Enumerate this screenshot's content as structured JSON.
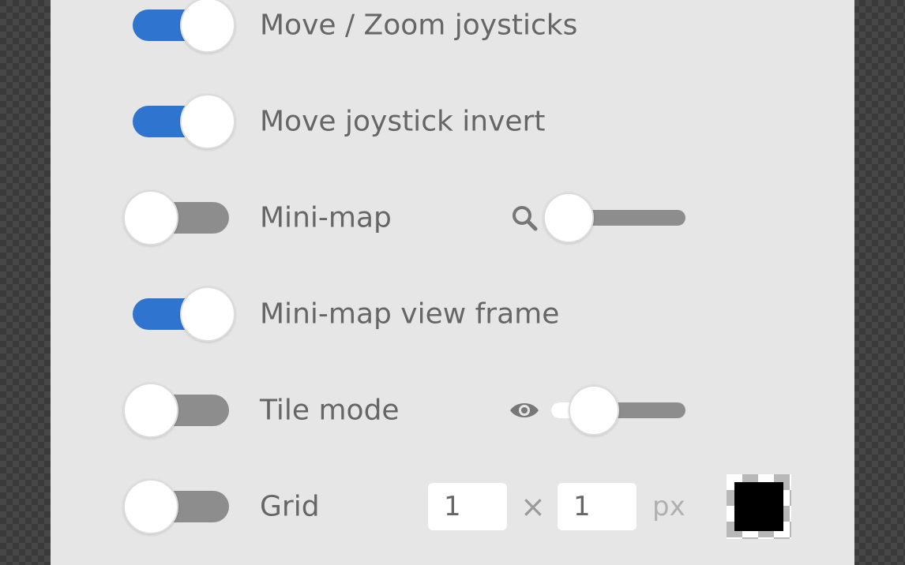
{
  "settings": {
    "joysticks": {
      "label": "Move / Zoom joysticks",
      "enabled": true
    },
    "joystick_invert": {
      "label": "Move joystick invert",
      "enabled": true
    },
    "minimap": {
      "label": "Mini-map",
      "enabled": false,
      "zoom_icon": "search-icon",
      "zoom_level": 0.0
    },
    "minimap_frame": {
      "label": "Mini-map view frame",
      "enabled": true
    },
    "tile_mode": {
      "label": "Tile mode",
      "enabled": false,
      "opacity_icon": "eye-icon",
      "opacity_level": 0.27
    },
    "grid": {
      "label": "Grid",
      "enabled": false,
      "width": "1",
      "height": "1",
      "times_symbol": "×",
      "unit": "px",
      "color": "#000000"
    }
  },
  "colors": {
    "accent": "#2f74cf",
    "track_off": "#8d8d8d",
    "panel_bg": "#e6e6e6",
    "text": "#666666"
  }
}
